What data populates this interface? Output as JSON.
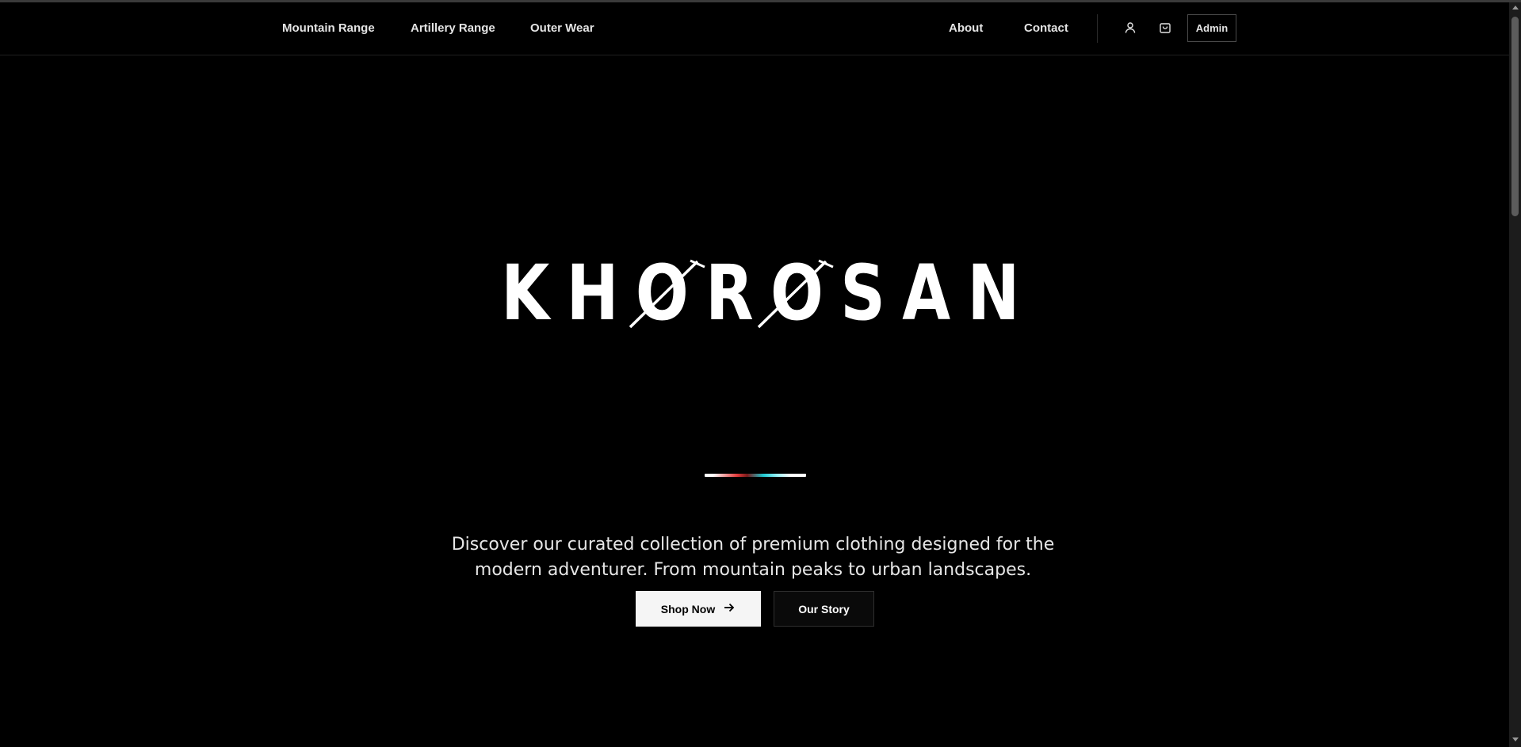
{
  "nav": {
    "left_links": [
      "Mountain Range",
      "Artillery Range",
      "Outer Wear"
    ],
    "right_links": [
      "About",
      "Contact"
    ],
    "user_icon": "user-icon",
    "cart_icon": "shopping-bag-icon",
    "admin_label": "Admin"
  },
  "hero": {
    "logo_text": "KHOROSAN",
    "accent_colors": [
      "#ffffff",
      "#e23b3b",
      "#1ecad3",
      "#ffffff"
    ],
    "tagline": "Discover our curated collection of premium clothing designed for the modern adventurer. From mountain peaks to urban landscapes.",
    "primary_button": "Shop Now",
    "primary_button_icon": "arrow-right-icon",
    "secondary_button": "Our Story"
  },
  "colors": {
    "background": "#000000",
    "text": "#ffffff",
    "button_light": "#f5f5f5"
  }
}
